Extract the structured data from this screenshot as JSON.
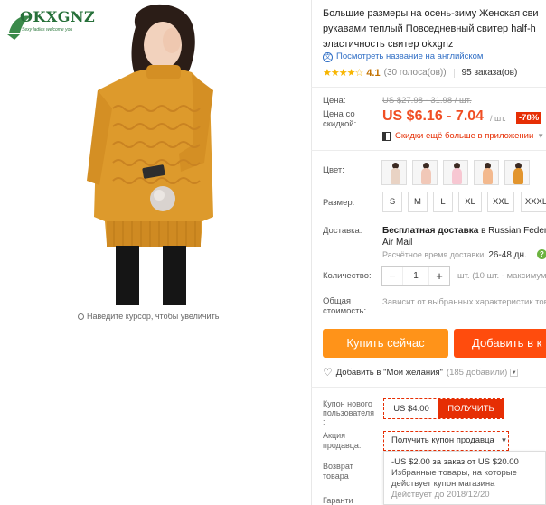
{
  "brand": {
    "logo_text": "OKXGNZ",
    "logo_tagline": "Sexy ladies welcome you"
  },
  "zoom_hint": "Наведите курсор, чтобы увеличить",
  "product": {
    "title_lines": [
      "Большие размеры на осень-зиму Женская сви",
      "рукавами теплый Повседневный свитер half-h",
      "эластичность свитер okxgnz"
    ],
    "translate_link": "Посмотреть название на английском",
    "rating": {
      "stars": 4.1,
      "score": "4.1",
      "votes": "(30 голоса(ов))",
      "orders": "95 заказа(ов)"
    }
  },
  "price": {
    "label": "Цена:",
    "old": "US $27.98 - 31.98 / шт.",
    "discount_label": "Цена со скидкой:",
    "new": "US $6.16 - 7.04",
    "per_unit": "/ шт.",
    "badge": "-78%",
    "app_promo": "Скидки ещё больше в приложении"
  },
  "options": {
    "color_label": "Цвет:",
    "swatches": [
      "#e9d3c4",
      "#f1c8b8",
      "#f7c7d2",
      "#f3b98e",
      "#e2952e",
      "#cf8a2b"
    ],
    "size_label": "Размер:",
    "sizes": [
      "S",
      "M",
      "L",
      "XL",
      "XXL",
      "XXXL"
    ]
  },
  "shipping": {
    "label": "Доставка:",
    "free": "Бесплатная доставка",
    "dest": " в Russian Federat",
    "carrier": "Air Mail",
    "time_label": "Расчётное время доставки:",
    "time_value": "26-48 дн."
  },
  "quantity": {
    "label": "Количество:",
    "value": "1",
    "minus": "−",
    "plus": "+",
    "note": "шт. (10 шт. - максимум"
  },
  "total": {
    "label": "Общая стоимость:",
    "value": "Зависит от выбранных характеристик тов"
  },
  "buttons": {
    "buy": "Купить сейчас",
    "cart": "Добавить в к"
  },
  "wishlist": {
    "label": "Добавить в \"Мои желания\"",
    "count": "(185 добавили)"
  },
  "coupons": {
    "new_user_label": "Купон нового пользователя :",
    "new_user_amount": "US $4.00",
    "get_label": "ПОЛУЧИТЬ",
    "seller_label": "Акция продавца:",
    "seller_dropdown": "Получить купон продавца",
    "popup_line1": "-US $2.00 за заказ от US $20.00",
    "popup_line2": "Избранные товары, на которые действует купон магазина",
    "popup_line3": "Действует до 2018/12/20",
    "return_label": "Возврат товара",
    "guarantee_label": "Гаранти"
  }
}
